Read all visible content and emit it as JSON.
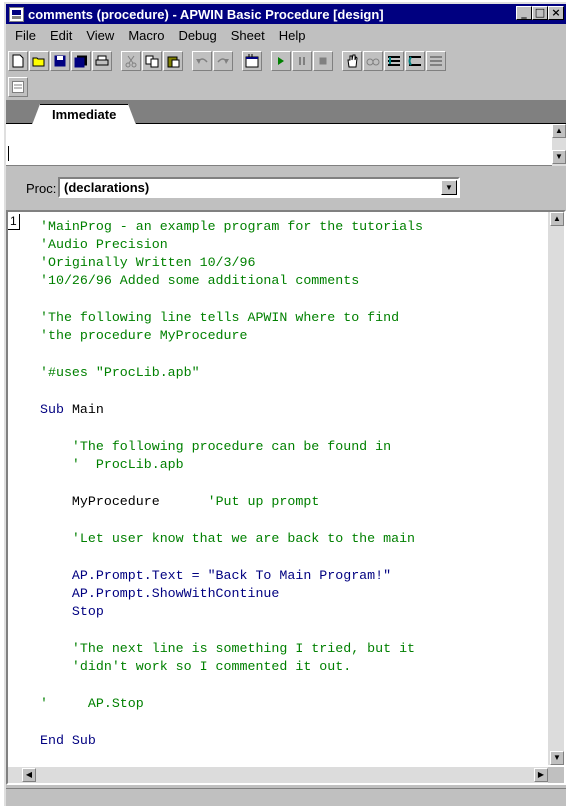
{
  "window": {
    "title": "comments (procedure) - APWIN Basic Procedure [design]",
    "buttons": [
      "_",
      "□",
      "×"
    ]
  },
  "menu": [
    {
      "label": "File"
    },
    {
      "label": "Edit"
    },
    {
      "label": "View"
    },
    {
      "label": "Macro"
    },
    {
      "label": "Debug"
    },
    {
      "label": "Sheet"
    },
    {
      "label": "Help"
    }
  ],
  "toolbar": {
    "icons": [
      "new-icon",
      "open-icon",
      "save-icon",
      "save-all-icon",
      "print-icon",
      "cut-icon",
      "copy-icon",
      "paste-icon",
      "undo-icon",
      "redo-icon",
      "dialog-editor-icon",
      "run-icon",
      "pause-icon",
      "stop-icon",
      "hand-icon",
      "watch-icon",
      "step-in-icon",
      "step-over-icon",
      "step-out-icon"
    ]
  },
  "tab": {
    "label": "Immediate"
  },
  "proc": {
    "label": "Proc:",
    "value": "(declarations)"
  },
  "editor": {
    "line_number": "1",
    "lines": [
      "'MainProg - an example program for the tutorials",
      "'Audio Precision",
      "'Originally Written 10/3/96",
      "'10/26/96 Added some additional comments",
      "'The following line tells APWIN where to find",
      "'the procedure MyProcedure",
      "'#uses \"ProcLib.apb\"",
      "Sub",
      "Main",
      "    'The following procedure can be found in",
      "    '  ProcLib.apb",
      "    MyProcedure",
      "'Put up prompt",
      "    'Let user know that we are back to the main",
      "    AP.Prompt.Text = \"Back To Main Program!\"",
      "    AP.Prompt.ShowWithContinue",
      "    Stop",
      "    'The next line is something I tried, but it",
      "    'didn't work so I commented it out.",
      "'     AP.Stop",
      "End Sub"
    ]
  },
  "colors": {
    "comment": "#008000",
    "keyword": "#000080",
    "title_bar": "#000080",
    "chrome": "#c0c0c0"
  }
}
